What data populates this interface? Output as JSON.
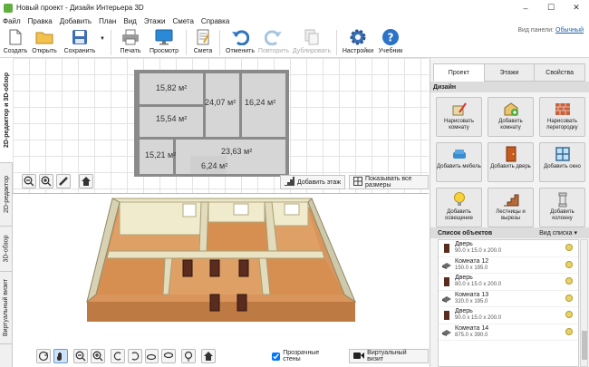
{
  "window": {
    "title": "Новый проект - Дизайн Интерьера 3D"
  },
  "menu": [
    "Файл",
    "Правка",
    "Добавить",
    "План",
    "Вид",
    "Этажи",
    "Смета",
    "Справка"
  ],
  "toolbar": {
    "items": [
      {
        "label": "Создать",
        "icon": "new-file-icon"
      },
      {
        "label": "Открыть",
        "icon": "folder-icon"
      },
      {
        "label": "Сохранить",
        "icon": "floppy-icon"
      },
      {
        "label": "Печать",
        "icon": "printer-icon"
      },
      {
        "label": "Просмотр",
        "icon": "monitor-icon"
      },
      {
        "label": "Смета",
        "icon": "estimate-icon"
      },
      {
        "label": "Отменить",
        "icon": "undo-icon"
      },
      {
        "label": "Повторить",
        "icon": "redo-icon"
      },
      {
        "label": "Дублировать",
        "icon": "duplicate-icon"
      },
      {
        "label": "Настройки",
        "icon": "gear-icon"
      },
      {
        "label": "Учебник",
        "icon": "help-icon"
      }
    ],
    "panel_view_label": "Вид панели:",
    "panel_view_value": "Обычный"
  },
  "left_tabs": [
    "2D-редактор и 3D-обзор",
    "2D-редактор",
    "3D-обзор",
    "Виртуальный визит"
  ],
  "plan": {
    "rooms": [
      "15,82 м²",
      "24,07 м²",
      "16,24 м²",
      "15,54 м²",
      "15,21 м²",
      "23,63 м²",
      "6,24 м²"
    ],
    "add_floor_label": "Добавить этаж",
    "show_sizes_label": "Показывать все размеры"
  },
  "view3d": {
    "transparent_walls_label": "Прозрачные стены",
    "transparent_walls_checked": true,
    "virtual_visit_label": "Виртуальный визит"
  },
  "right_panel": {
    "tabs": [
      "Проект",
      "Этажи",
      "Свойства"
    ],
    "active_tab": "Проект",
    "design_section": "Дизайн",
    "design_buttons": [
      {
        "label": "Нарисовать комнату",
        "icon": "draw-room-icon"
      },
      {
        "label": "Добавить комнату",
        "icon": "add-room-icon"
      },
      {
        "label": "Нарисовать перегородку",
        "icon": "brick-wall-icon"
      },
      {
        "label": "Добавить мебель",
        "icon": "sofa-icon"
      },
      {
        "label": "Добавить дверь",
        "icon": "door-icon"
      },
      {
        "label": "Добавить окно",
        "icon": "window-icon"
      },
      {
        "label": "Добавить освещение",
        "icon": "lamp-icon"
      },
      {
        "label": "Лестницы и вырезы",
        "icon": "stairs-icon"
      },
      {
        "label": "Добавить колонну",
        "icon": "column-icon"
      }
    ],
    "objects_title": "Список объектов",
    "objects_view_label": "Вид списка",
    "objects": [
      {
        "name": "Дверь",
        "dims": "90.0 x 15.0 x 200.0",
        "type": "door"
      },
      {
        "name": "Комната 12",
        "dims": "150.0 x 195.0",
        "type": "room"
      },
      {
        "name": "Дверь",
        "dims": "80.0 x 15.0 x 200.0",
        "type": "door"
      },
      {
        "name": "Комната 13",
        "dims": "320.0 x 195.0",
        "type": "room"
      },
      {
        "name": "Дверь",
        "dims": "90.0 x 15.0 x 200.0",
        "type": "door"
      },
      {
        "name": "Комната 14",
        "dims": "875.0 x 390.0",
        "type": "room"
      }
    ]
  },
  "colors": {
    "accent": "#1c5fa8",
    "floor": "#d9955b",
    "wall": "#ece6c8"
  }
}
